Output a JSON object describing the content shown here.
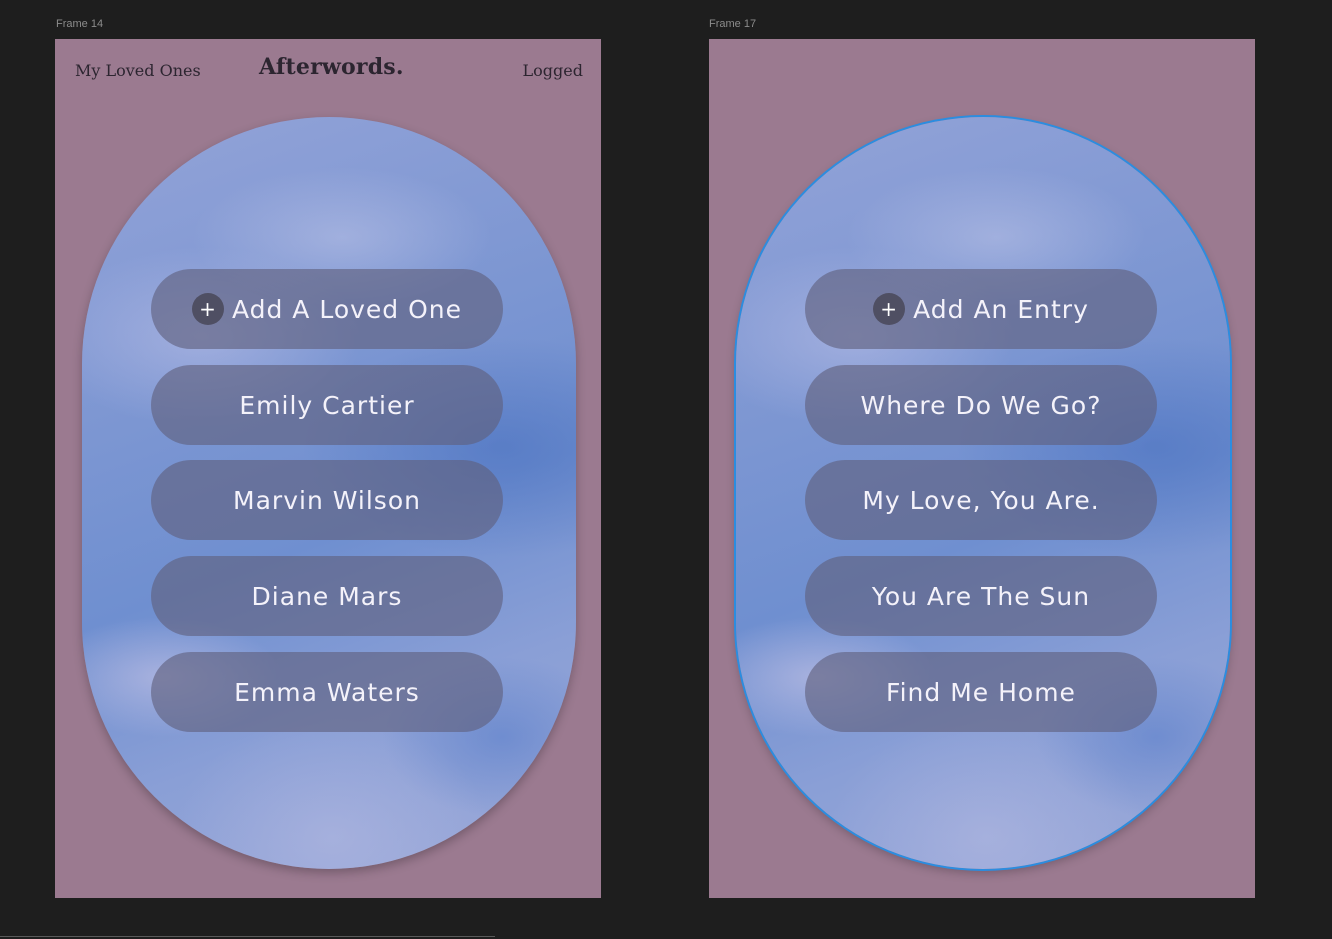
{
  "canvas": {
    "frames": [
      {
        "label": "Frame 14",
        "nav": {
          "left": "My Loved Ones",
          "brand": "Afterwords.",
          "right": "Logged"
        },
        "add_button": {
          "icon": "+",
          "label": "Add A Loved One"
        },
        "items": [
          "Emily Cartier",
          "Marvin Wilson",
          "Diane Mars",
          "Emma Waters"
        ]
      },
      {
        "label": "Frame 17",
        "add_button": {
          "icon": "+",
          "label": "Add An Entry"
        },
        "items": [
          "Where Do We Go?",
          "My Love, You Are.",
          "You Are The Sun",
          "Find Me Home"
        ]
      }
    ]
  },
  "colors": {
    "canvas_bg": "#1e1e1e",
    "frame_bg": "#9b7a90",
    "pill_bg": "rgba(95,95,125,0.62)",
    "selection": "#2b8de0"
  }
}
